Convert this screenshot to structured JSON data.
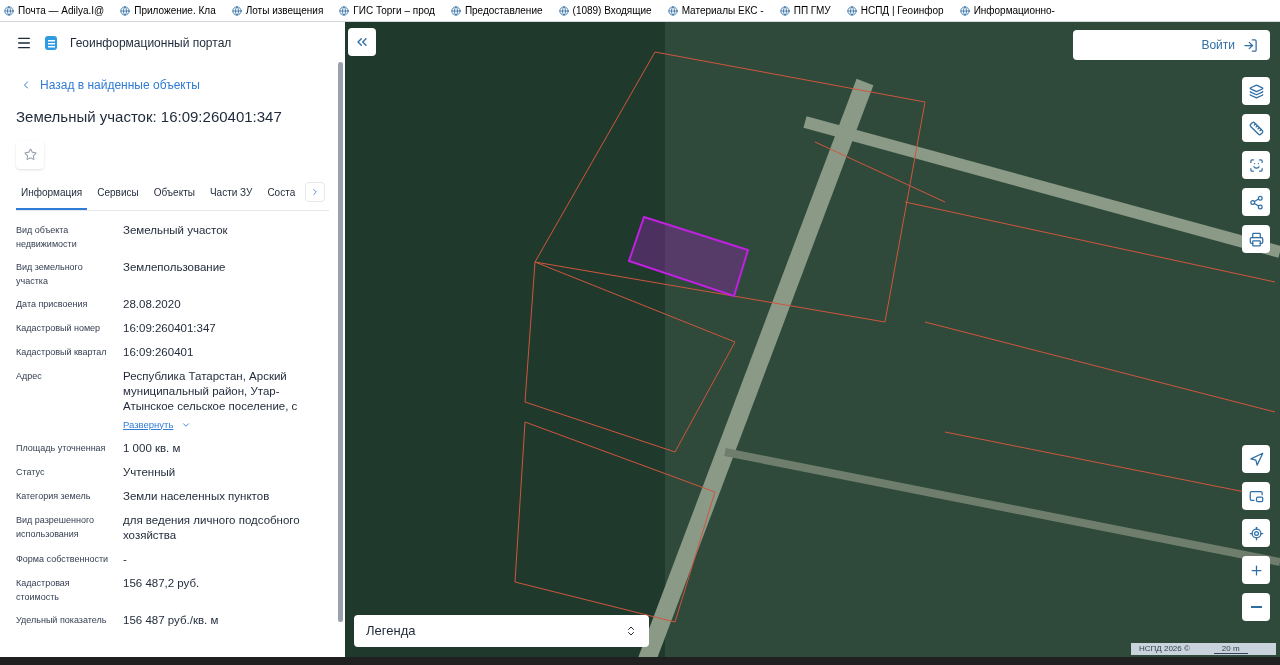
{
  "bookmarks": [
    {
      "label": "Почта — Adilya.I@"
    },
    {
      "label": "Приложение. Кла"
    },
    {
      "label": "Лоты извещения"
    },
    {
      "label": "ГИС Торги – прод"
    },
    {
      "label": "Предоставление"
    },
    {
      "label": "(1089) Входящие"
    },
    {
      "label": "Материалы ЕКС -"
    },
    {
      "label": "ПП ГМУ"
    },
    {
      "label": "НСПД | Геоинфор"
    },
    {
      "label": "Информационно-"
    }
  ],
  "header": {
    "title": "Геоинформационный портал"
  },
  "back_link": "Назад в найденные объекты",
  "object_title": "Земельный участок: 16:09:260401:347",
  "favorite": {
    "on": false
  },
  "tabs": [
    {
      "label": "Информация",
      "selected": true
    },
    {
      "label": "Сервисы",
      "selected": false
    },
    {
      "label": "Объекты",
      "selected": false
    },
    {
      "label": "Части ЗУ",
      "selected": false
    },
    {
      "label": "Соста",
      "selected": false
    }
  ],
  "fields": [
    {
      "label": "Вид объекта недвижимости",
      "value": "Земельный участок"
    },
    {
      "label": "Вид земельного участка",
      "value": "Землепользование"
    },
    {
      "label": "Дата присвоения",
      "value": "28.08.2020"
    },
    {
      "label": "Кадастровый номер",
      "value": "16:09:260401:347"
    },
    {
      "label": "Кадастровый квартал",
      "value": "16:09:260401"
    },
    {
      "label": "Адрес",
      "value": "Республика Татарстан, Арский муниципальный район, Утар-Атынское сельское поселение, с",
      "expand": "Развернуть"
    },
    {
      "label": "Площадь уточненная",
      "value": "1 000 кв. м"
    },
    {
      "label": "Статус",
      "value": "Учтенный"
    },
    {
      "label": "Категория земель",
      "value": "Земли населенных пунктов"
    },
    {
      "label": "Вид разрешенного использования",
      "value": "для ведения личного подсобного хозяйства"
    },
    {
      "label": "Форма собственности",
      "value": "-"
    },
    {
      "label": "Кадастровая стоимость",
      "value": "156 487,2 руб."
    },
    {
      "label": "Удельный показатель",
      "value": "156 487 руб./кв. м"
    }
  ],
  "map": {
    "login": "Войти",
    "legend": "Легенда",
    "attribution": "НСПД 2026 ©",
    "scale": "20 m"
  }
}
